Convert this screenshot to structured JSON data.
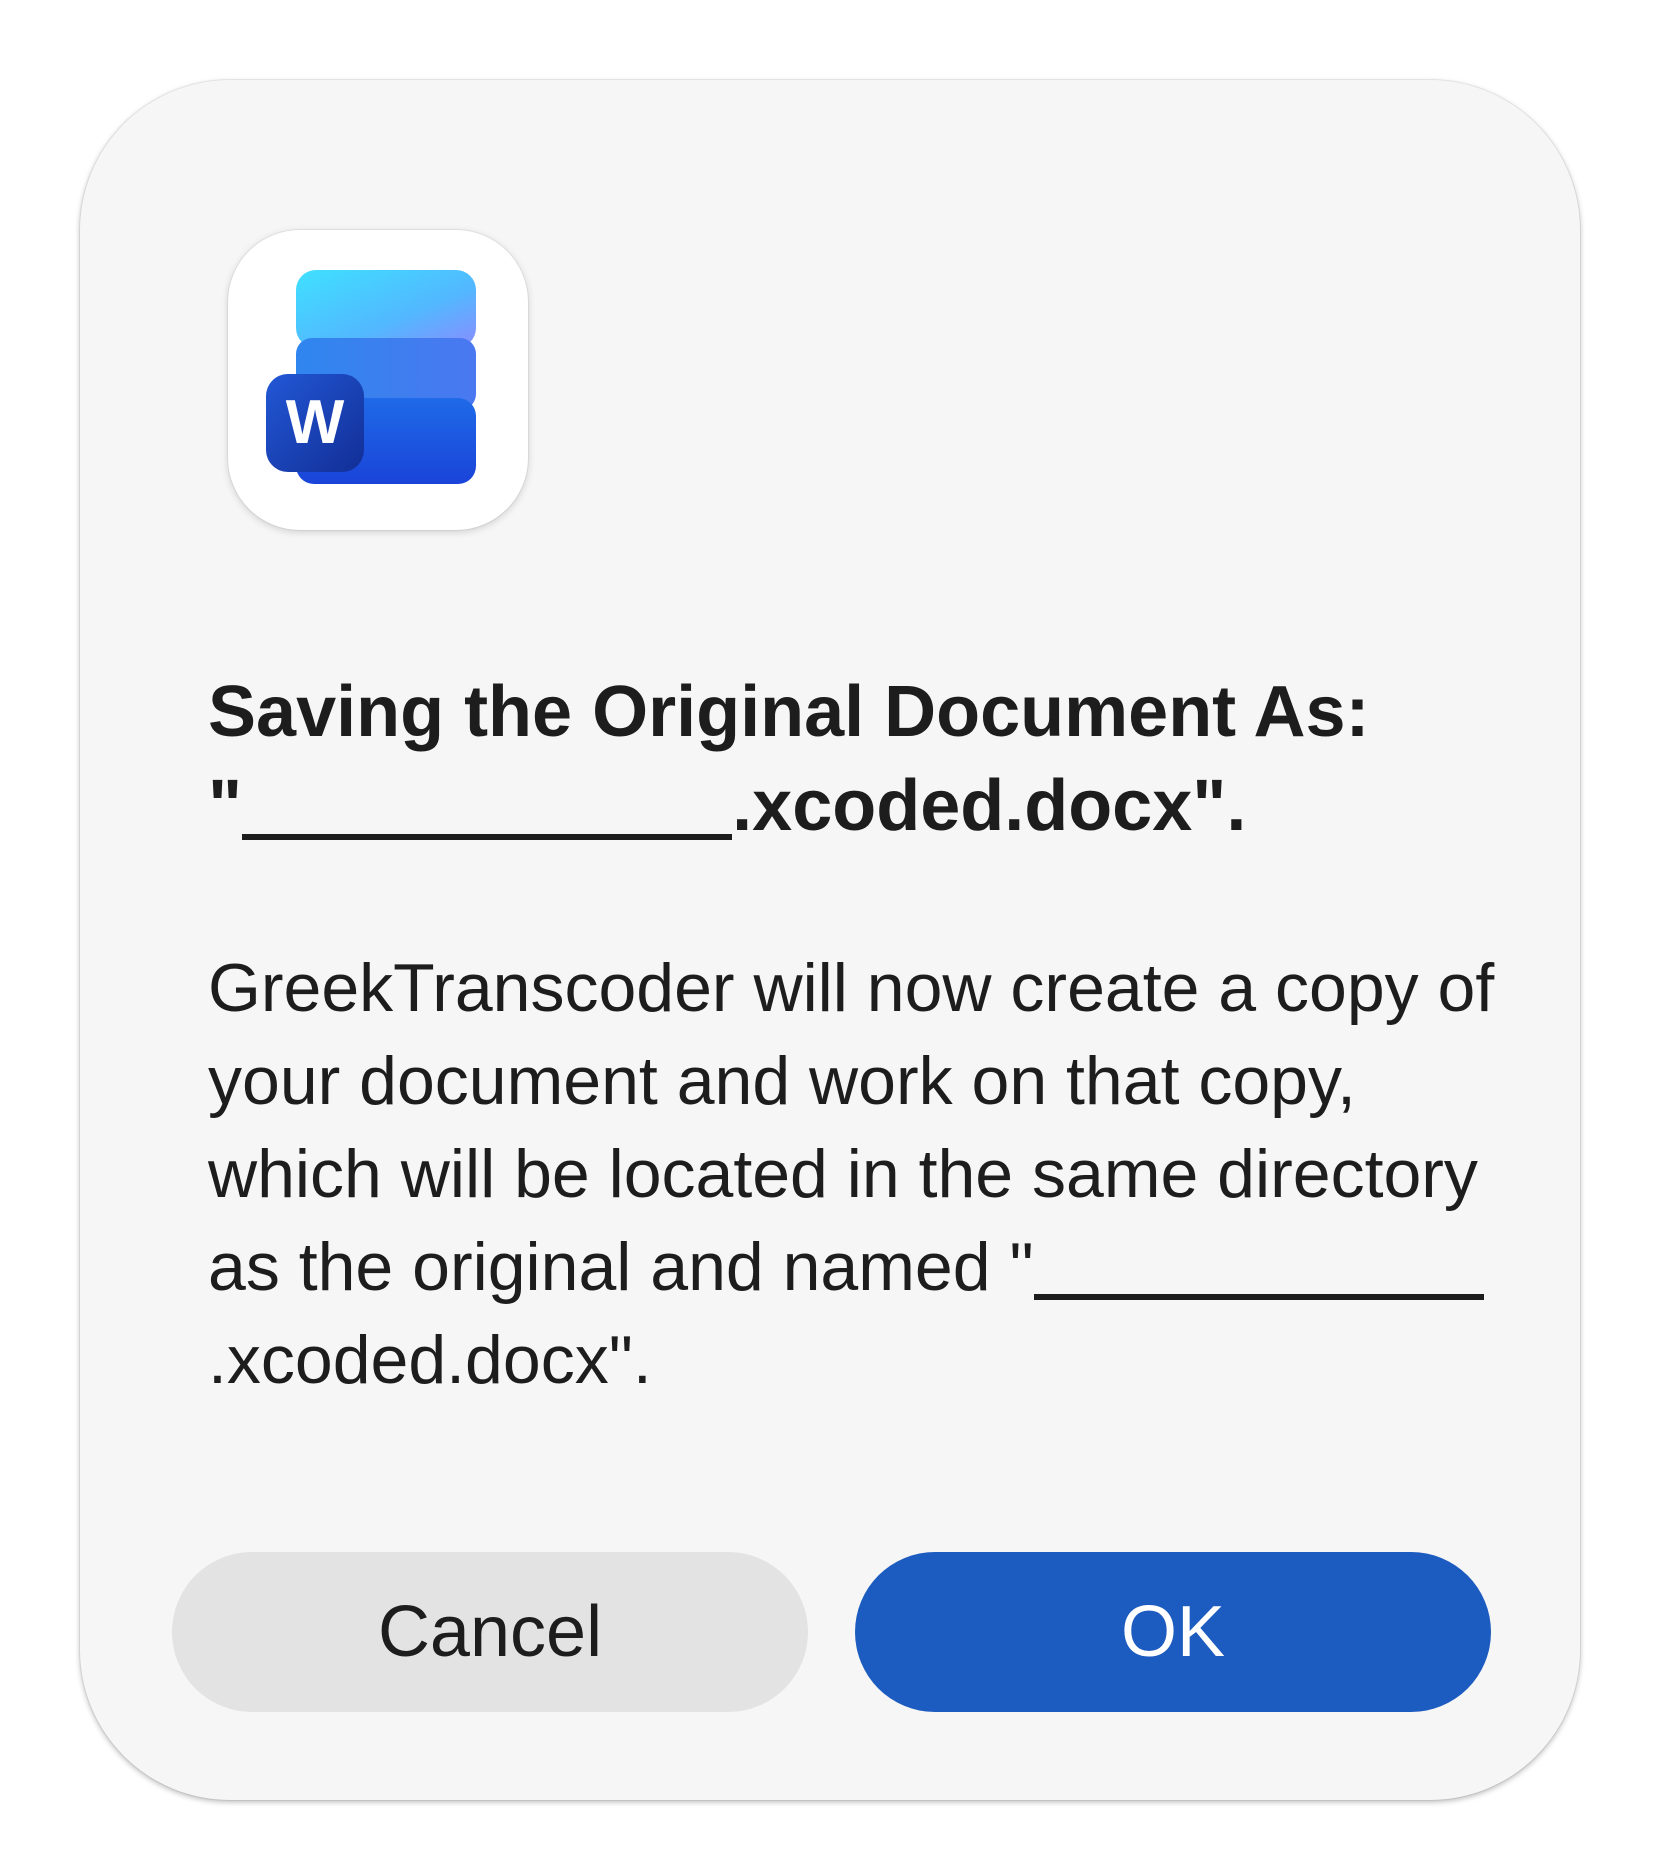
{
  "dialog": {
    "icon": "microsoft-word-icon",
    "icon_letter": "W",
    "title": {
      "line1": "Saving the Original Document As:",
      "line2_prefix": "\"",
      "line2_suffix": ".xcoded.docx\"."
    },
    "message": {
      "text": "GreekTranscoder will now create a copy of your document and work on that copy, which will be located in the same directory as the original and named",
      "prefix": "\"",
      "suffix": ".xcoded.docx\"."
    },
    "buttons": {
      "cancel": "Cancel",
      "ok": "OK"
    }
  },
  "colors": {
    "dialog_background": "#f6f6f6",
    "primary_button": "#1c5bbf",
    "secondary_button": "#e3e3e3",
    "text": "#1d1d1d"
  }
}
